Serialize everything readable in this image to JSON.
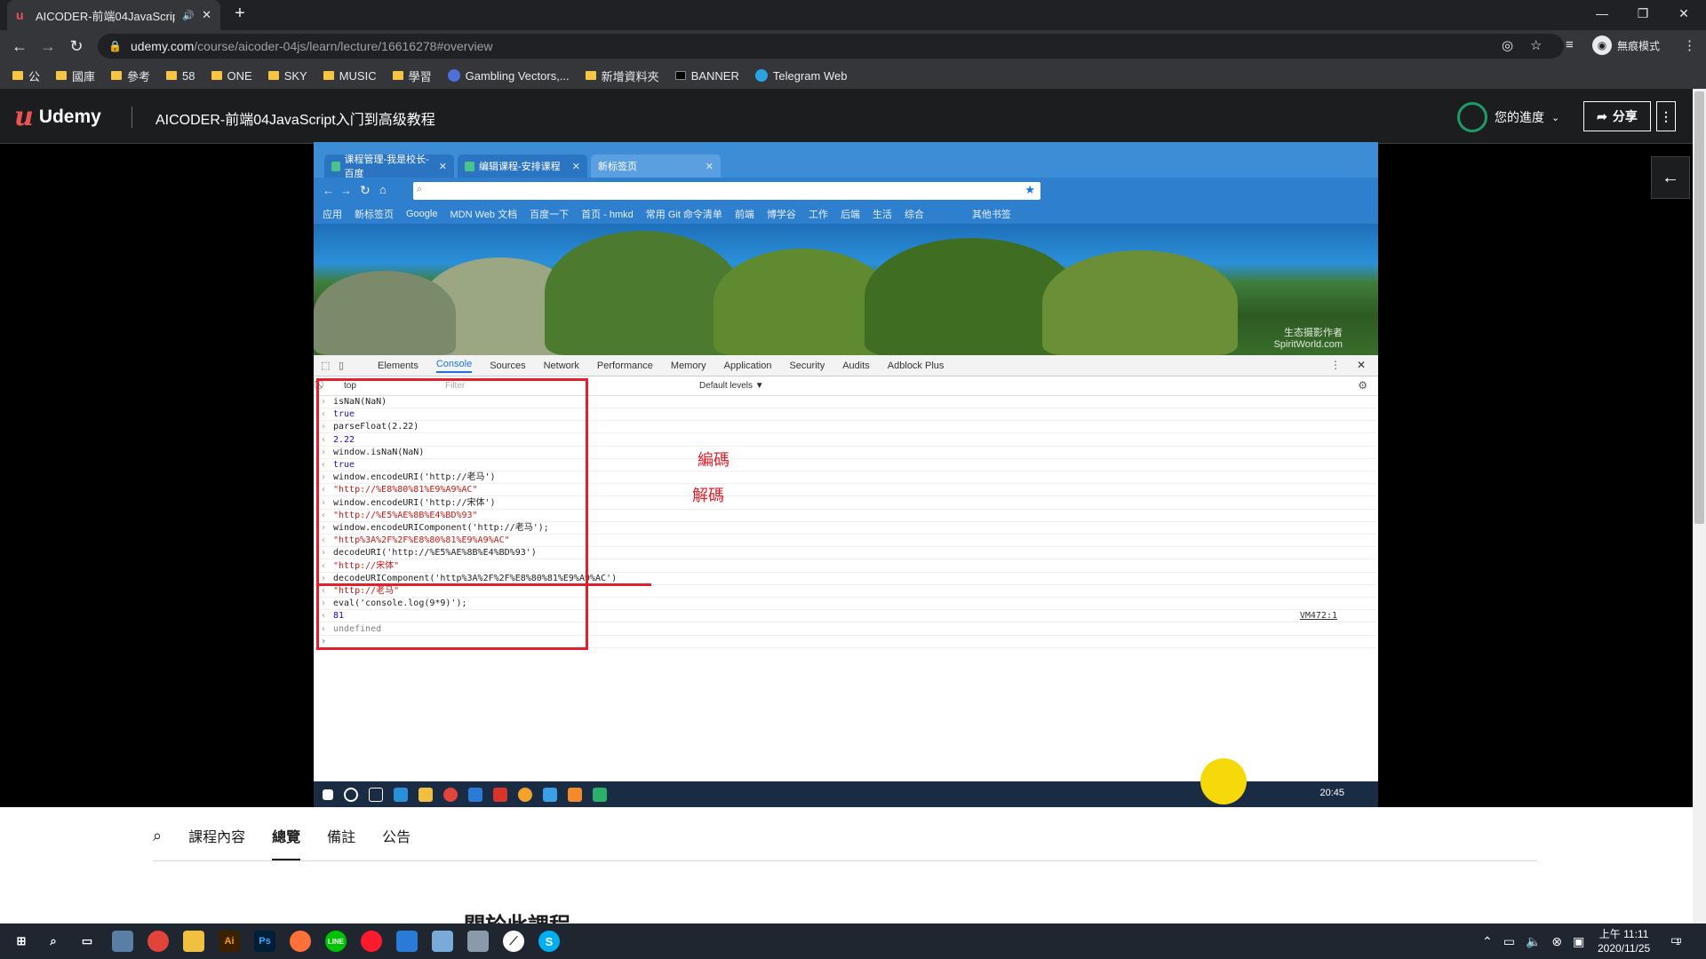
{
  "browser": {
    "tab_title": "AICODER-前端04JavaScript",
    "url_host": "udemy.com",
    "url_path": "/course/aicoder-04js/learn/lecture/16616278#overview",
    "incognito_label": "無痕模式"
  },
  "bookmarks": [
    {
      "label": "公",
      "icon": "folder"
    },
    {
      "label": "國庫",
      "icon": "folder"
    },
    {
      "label": "參考",
      "icon": "folder"
    },
    {
      "label": "58",
      "icon": "folder"
    },
    {
      "label": "ONE",
      "icon": "folder"
    },
    {
      "label": "SKY",
      "icon": "folder"
    },
    {
      "label": "MUSIC",
      "icon": "folder"
    },
    {
      "label": "學習",
      "icon": "folder"
    },
    {
      "label": "Gambling Vectors,...",
      "icon": "globe"
    },
    {
      "label": "新增資料夾",
      "icon": "folder"
    },
    {
      "label": "BANNER",
      "icon": "terminal"
    },
    {
      "label": "Telegram Web",
      "icon": "telegram"
    }
  ],
  "udemy": {
    "logo": "Udemy",
    "course_title": "AICODER-前端04JavaScript入门到高级教程",
    "progress_label": "您的進度",
    "share_label": "分享"
  },
  "inner": {
    "tabs": [
      {
        "label": "课程管理-我是校长-百度"
      },
      {
        "label": "编辑课程-安排课程"
      },
      {
        "label": "新标签页"
      }
    ],
    "bookmarks": [
      "应用",
      "新标签页",
      "Google",
      "MDN Web 文档",
      "百度一下",
      "首页 - hmkd",
      "常用 Git 命令清单",
      "前端",
      "博学谷",
      "工作",
      "后端",
      "生活",
      "综合",
      "其他书签"
    ],
    "banner_credit_1": "生态摄影作者",
    "banner_credit_2": "SpiritWorld.com",
    "devtools_tabs": [
      "Elements",
      "Console",
      "Sources",
      "Network",
      "Performance",
      "Memory",
      "Application",
      "Security",
      "Audits",
      "Adblock Plus"
    ],
    "context": "top",
    "filter_placeholder": "Filter",
    "levels": "Default levels ▼",
    "console": [
      {
        "kind": "in",
        "text": "isNaN(NaN)"
      },
      {
        "kind": "out",
        "text": "true"
      },
      {
        "kind": "in",
        "text": "parseFloat(2.22)"
      },
      {
        "kind": "num",
        "text": "2.22"
      },
      {
        "kind": "in",
        "text": "window.isNaN(NaN)"
      },
      {
        "kind": "out",
        "text": "true"
      },
      {
        "kind": "in",
        "text": "window.encodeURI('http://老马')"
      },
      {
        "kind": "str",
        "text": "\"http://%E8%80%81%E9%A9%AC\""
      },
      {
        "kind": "in",
        "text": "window.encodeURI('http://宋体')"
      },
      {
        "kind": "str",
        "text": "\"http://%E5%AE%8B%E4%BD%93\""
      },
      {
        "kind": "in",
        "text": "window.encodeURIComponent('http://老马');"
      },
      {
        "kind": "str",
        "text": "\"http%3A%2F%2F%E8%80%81%E9%A9%AC\""
      },
      {
        "kind": "in",
        "text": "decodeURI('http://%E5%AE%8B%E4%BD%93')"
      },
      {
        "kind": "str",
        "text": "\"http://宋体\""
      },
      {
        "kind": "in",
        "text": "decodeURIComponent('http%3A%2F%2F%E8%80%81%E9%A9%AC')"
      },
      {
        "kind": "str",
        "text": "\"http://老马\""
      },
      {
        "kind": "in",
        "text": "eval('console.log(9*9)');"
      },
      {
        "kind": "num",
        "text": "81",
        "src": "VM472:1"
      },
      {
        "kind": "undef",
        "text": "undefined"
      },
      {
        "kind": "prompt",
        "text": ""
      }
    ],
    "annotation_encode": "編碼",
    "annotation_decode": "解碼",
    "clock": "20:45"
  },
  "course_tabs": {
    "items": [
      "課程內容",
      "總覽",
      "備註",
      "公告"
    ],
    "active_index": 1
  },
  "about_heading": "關於此課程",
  "taskbar": {
    "time": "上午 11:11",
    "date": "2020/11/25",
    "notification_count": "1"
  },
  "colors": {
    "udemy_red": "#ec5252",
    "annotation_red": "#e0202a",
    "progress_green": "#1e9b6b"
  }
}
